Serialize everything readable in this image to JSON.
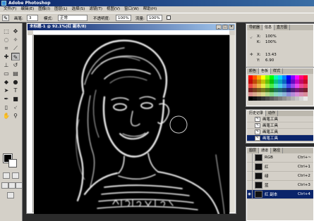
{
  "app": {
    "title": "Adobe Photoshop"
  },
  "menu": [
    "文件(F)",
    "编辑(E)",
    "图像(I)",
    "图层(L)",
    "选择(S)",
    "滤镜(T)",
    "视图(V)",
    "窗口(W)",
    "帮助(H)"
  ],
  "options": {
    "brush_label": "画笔:",
    "brush_size": "3",
    "mode_label": "模式:",
    "mode_value": "正常",
    "opacity_label": "不透明度:",
    "opacity_value": "100%",
    "flow_label": "流量:",
    "flow_value": "100%"
  },
  "document": {
    "title": "未标题-1 @ 92.1%(红 副本/8)"
  },
  "navigator": {
    "tabs": [
      "导航器",
      "信息",
      "直方图"
    ],
    "xy_label": "X:",
    "xy_value": "100%",
    "k_label": "K:",
    "k_value": "100%",
    "x_label": "X:",
    "x_value": "13.43",
    "y_label": "Y:",
    "y_value": "6.90"
  },
  "swatches": {
    "tabs": [
      "颜色",
      "色板",
      "样式"
    ]
  },
  "history": {
    "tabs": [
      "历史记录",
      "动作"
    ],
    "items": [
      "画笔工具",
      "画笔工具",
      "画笔工具",
      "画笔工具"
    ],
    "selected_index": 3
  },
  "channels": {
    "tabs": [
      "图层",
      "通道",
      "路径"
    ],
    "items": [
      {
        "name": "RGB",
        "key": "Ctrl+~"
      },
      {
        "name": "红",
        "key": "Ctrl+1"
      },
      {
        "name": "绿",
        "key": "Ctrl+2"
      },
      {
        "name": "蓝",
        "key": "Ctrl+3"
      },
      {
        "name": "红 副本",
        "key": "Ctrl+4"
      }
    ],
    "selected_index": 4
  },
  "colors": {
    "foreground": "#000000",
    "background": "#ffffff",
    "selection": "#0a246a"
  }
}
